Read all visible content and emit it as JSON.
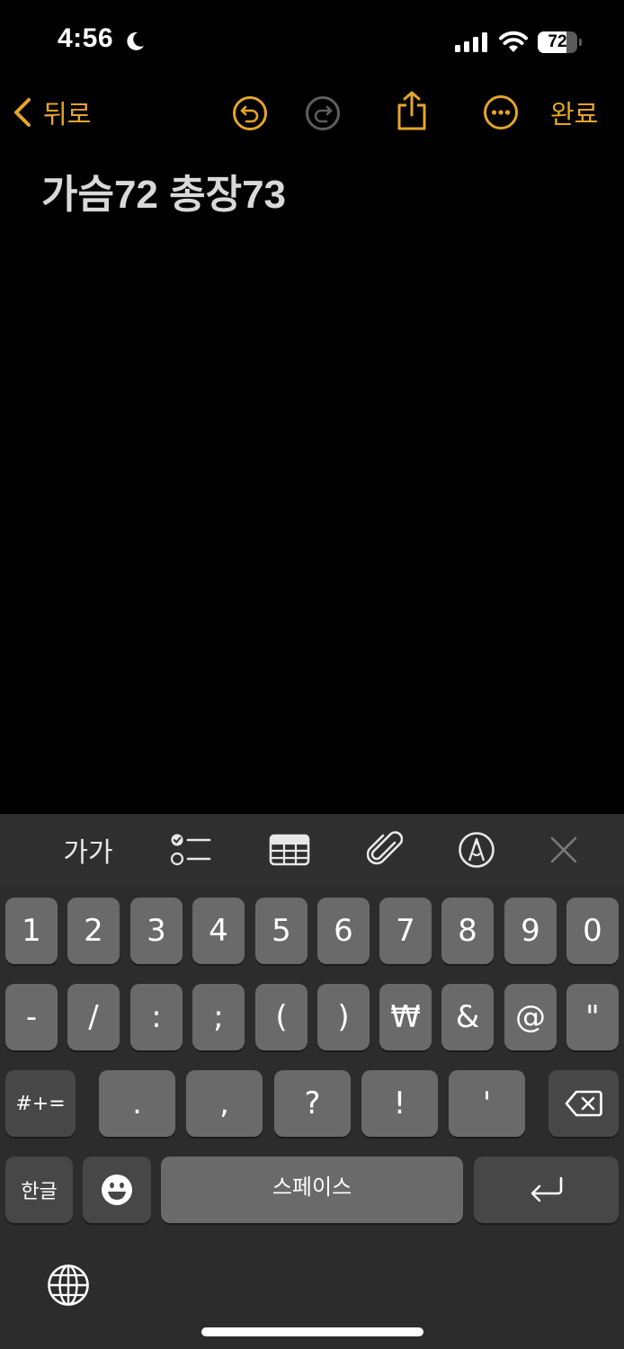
{
  "status_bar": {
    "time": "4:56",
    "battery_percent": 72,
    "battery_label": "72"
  },
  "colors": {
    "accent": "#e5a52a",
    "background": "#000000",
    "key": "#6a6a6a",
    "key_dark": "#474747"
  },
  "nav": {
    "back_label": "뒤로",
    "done_label": "완료",
    "icons": [
      "chevron-left-icon",
      "undo-icon",
      "redo-icon",
      "share-icon",
      "more-icon"
    ]
  },
  "note": {
    "title": "가슴72 총장73"
  },
  "format_toolbar": {
    "text_format_label": "가가",
    "icons": [
      "checklist-icon",
      "table-icon",
      "attachment-icon",
      "markup-icon",
      "close-icon"
    ]
  },
  "keyboard": {
    "row1": [
      "1",
      "2",
      "3",
      "4",
      "5",
      "6",
      "7",
      "8",
      "9",
      "0"
    ],
    "row2": [
      "-",
      "/",
      ":",
      ";",
      "(",
      ")",
      "₩",
      "&",
      "@",
      "\""
    ],
    "row3": [
      "#+=",
      ".",
      ",",
      "?",
      "!",
      "'"
    ],
    "row3_icons": [
      "backspace-icon"
    ],
    "row4": {
      "lang_label": "한글",
      "space_label": "스페이스"
    },
    "row4_icons": [
      "emoji-icon",
      "return-icon"
    ],
    "bottom_icons": [
      "globe-icon"
    ]
  }
}
